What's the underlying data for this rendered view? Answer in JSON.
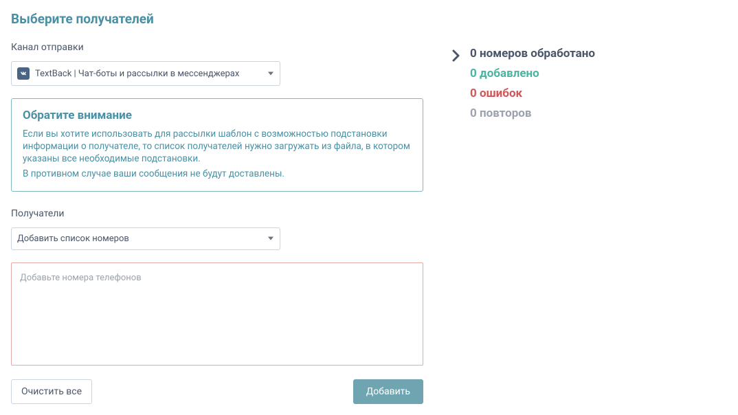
{
  "title": "Выберите получателей",
  "channel": {
    "label": "Канал отправки",
    "selected": "TextBack | Чат-боты и рассылки в мессенджерах"
  },
  "info": {
    "title": "Обратите внимание",
    "text1": "Если вы хотите использовать для рассылки шаблон с возможностью подстановки информации о получателе, то список получателей нужно загружать из файла, в котором указаны все необходимые подстановки.",
    "text2": "В противном случае ваши сообщения не будут доставлены."
  },
  "recipients": {
    "label": "Получатели",
    "selected": "Добавить список номеров",
    "placeholder": "Добавьте номера телефонов",
    "value": ""
  },
  "buttons": {
    "clear": "Очистить все",
    "add": "Добавить"
  },
  "stats": {
    "processed": "0 номеров обработано",
    "added": "0 добавлено",
    "errors": "0 ошибок",
    "repeats": "0 повторов"
  }
}
